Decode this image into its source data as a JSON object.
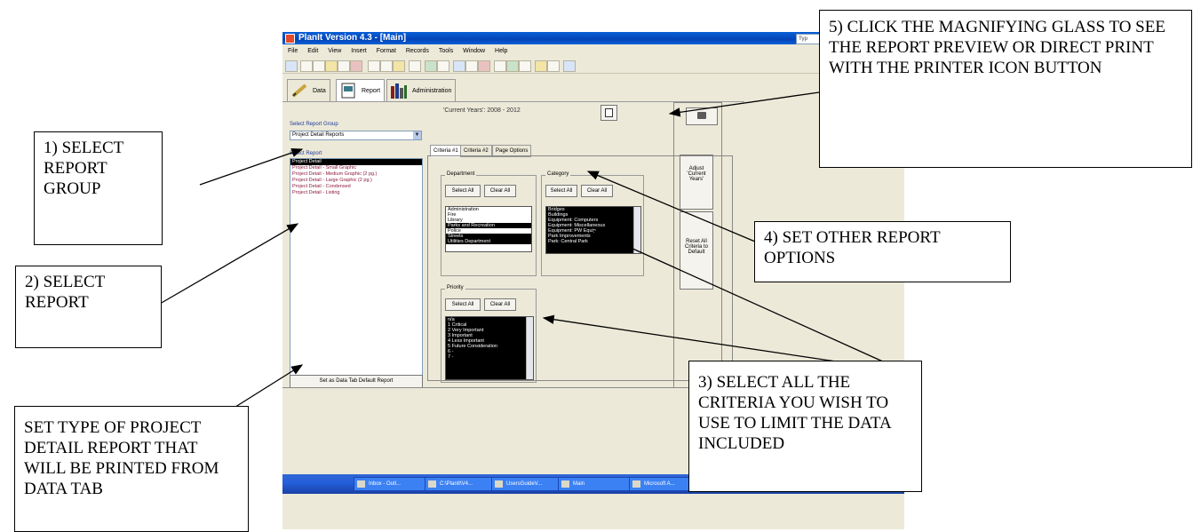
{
  "window": {
    "title": "PlanIt Version 4.3 - [Main]",
    "menu": [
      "File",
      "Edit",
      "View",
      "Insert",
      "Format",
      "Records",
      "Tools",
      "Window",
      "Help"
    ],
    "type_help": "Typ"
  },
  "module_tabs": [
    {
      "label": "Data",
      "icon": "pencil-icon"
    },
    {
      "label": "Report",
      "icon": "report-icon"
    },
    {
      "label": "Administration",
      "icon": "books-icon"
    }
  ],
  "report_panel": {
    "current_years": "'Current Years': 2008 - 2012",
    "report_group_label": "Select Report Group",
    "report_group_value": "Project Detail Reports",
    "select_report_label": "Select Report",
    "reports": [
      "Project Detail",
      "Project Detail - Small Graphic",
      "Project Detail - Medium Graphic (2 pg.)",
      "Project Detail - Large Graphic (2 pg.)",
      "Project Detail - Condensed",
      "Project Detail - Listing"
    ],
    "default_button": "Set as Data Tab Default Report"
  },
  "criteria": {
    "tabs": [
      "Criteria #1",
      "Criteria #2",
      "Page Options"
    ],
    "department": {
      "label": "Department",
      "select_all": "Select All",
      "clear_all": "Clear All",
      "items": [
        "Administration",
        "Fire",
        "Library",
        "Parks and Recreation",
        "Police",
        "Streets",
        "Utilities Department"
      ]
    },
    "category": {
      "label": "Category",
      "select_all": "Select All",
      "clear_all": "Clear All",
      "items": [
        "Bridges",
        "Buildings",
        "Equipment: Computers",
        "Equipment: Miscellaneous",
        "Equipment: PW Equip",
        "Park Improvements",
        "Park: Central Park"
      ]
    },
    "priority": {
      "label": "Priority",
      "select_all": "Select All",
      "clear_all": "Clear All",
      "items": [
        "n/a",
        "1 Critical",
        "2 Very Important",
        "3 Important",
        "4 Less Important",
        "5 Future Consideration",
        "6 -",
        "7 -"
      ]
    }
  },
  "side_buttons": {
    "adjust": "Adjust 'Current Years'",
    "reset": "Reset All Criteria to Default"
  },
  "taskbar": [
    "Inbox - Outl...",
    "C:\\PlanIt\\V4...",
    "UsersGuideV...",
    "Main",
    "Microsoft A..."
  ],
  "callouts": {
    "c1": "1) SELECT REPORT GROUP",
    "c2": "2) SELECT REPORT",
    "c3": "3) SELECT ALL THE CRITERIA YOU WISH TO USE TO LIMIT THE DATA INCLUDED",
    "c4": "4) SET OTHER REPORT OPTIONS",
    "c5": "5) CLICK THE MAGNIFYING GLASS TO SEE THE REPORT PREVIEW OR DIRECT PRINT WITH THE PRINTER ICON BUTTON",
    "c6": "SET TYPE OF PROJECT DETAIL REPORT THAT WILL BE PRINTED FROM DATA TAB"
  }
}
